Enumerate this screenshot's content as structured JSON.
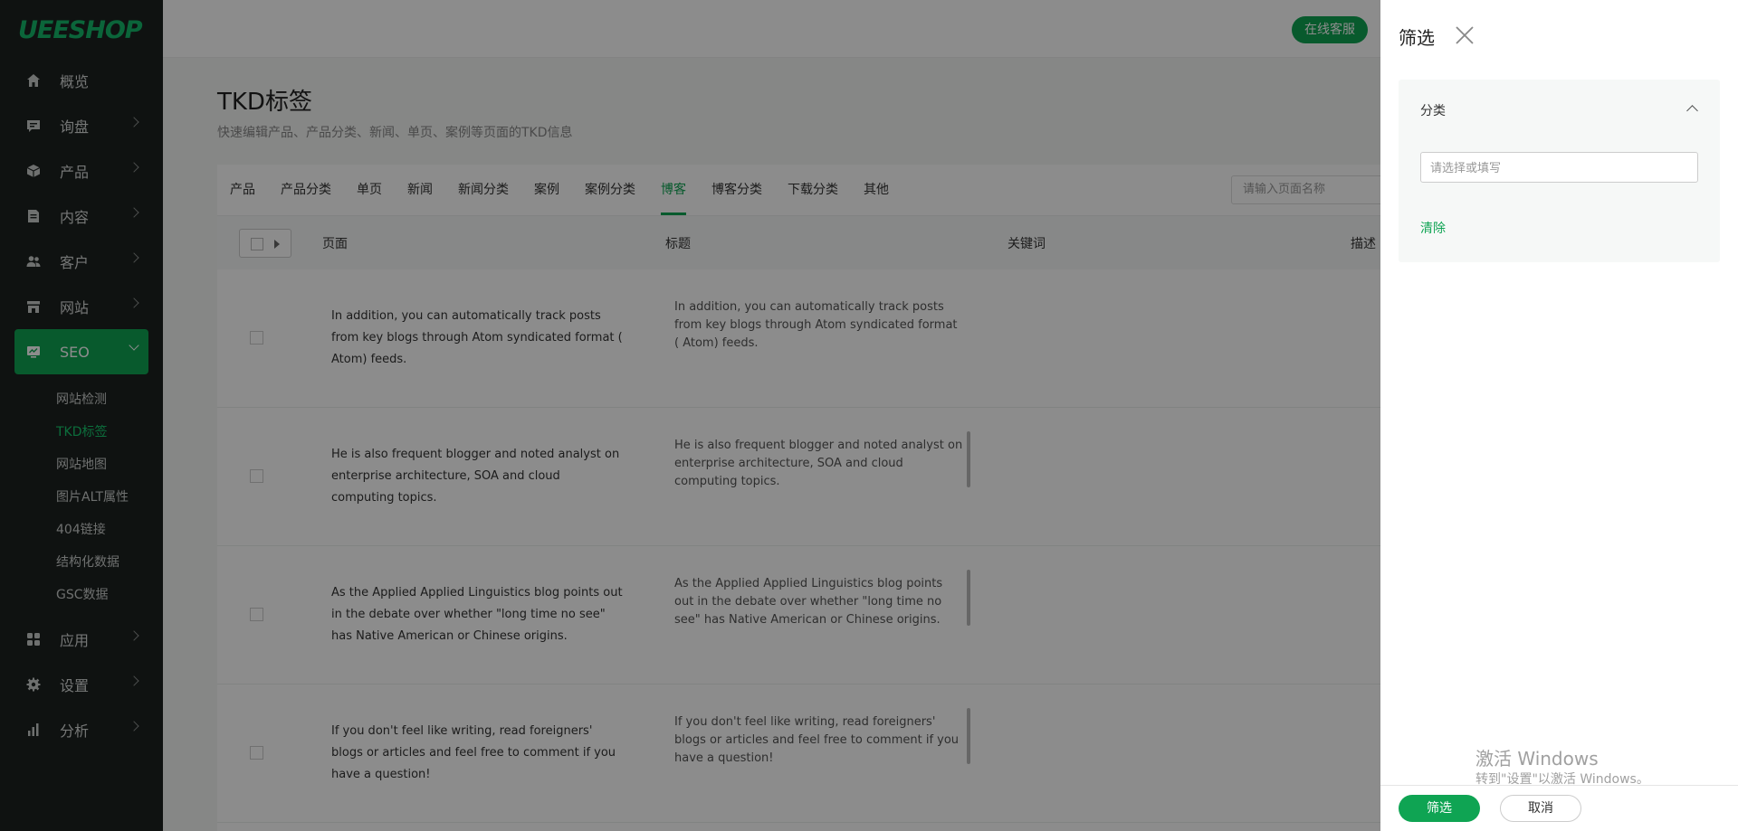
{
  "brand": {
    "logo_text": "UEESHOP"
  },
  "sidebar": {
    "items": [
      {
        "label": "概览",
        "icon": "home-icon"
      },
      {
        "label": "询盘",
        "icon": "chat-icon"
      },
      {
        "label": "产品",
        "icon": "box-icon"
      },
      {
        "label": "内容",
        "icon": "document-icon"
      },
      {
        "label": "客户",
        "icon": "users-icon"
      },
      {
        "label": "网站",
        "icon": "store-icon"
      },
      {
        "label": "SEO",
        "icon": "monitor-icon"
      },
      {
        "label": "应用",
        "icon": "apps-icon"
      },
      {
        "label": "设置",
        "icon": "gear-icon"
      },
      {
        "label": "分析",
        "icon": "bar-chart-icon"
      }
    ],
    "seo_sub": [
      "网站检测",
      "TKD标签",
      "网站地图",
      "图片ALT属性",
      "404链接",
      "结构化数据",
      "GSC数据"
    ]
  },
  "topbar": {
    "online_service": "在线客服"
  },
  "page": {
    "title": "TKD标签",
    "subtitle": "快速编辑产品、产品分类、新闻、单页、案例等页面的TKD信息"
  },
  "tabs": [
    "产品",
    "产品分类",
    "单页",
    "新闻",
    "新闻分类",
    "案例",
    "案例分类",
    "博客",
    "博客分类",
    "下载分类",
    "其他"
  ],
  "search": {
    "placeholder": "请输入页面名称"
  },
  "table": {
    "headers": {
      "page": "页面",
      "title": "标题",
      "keywords": "关键词",
      "description": "描述"
    },
    "rows": [
      {
        "page": "In addition, you can automatically track posts from key blogs through Atom syndicated format ( Atom) feeds.",
        "title": "In addition, you can automatically track posts from key blogs through Atom syndicated format ( Atom) feeds."
      },
      {
        "page": "He is also frequent blogger and noted analyst on enterprise architecture, SOA and cloud computing topics.",
        "title": "He is also frequent blogger and noted analyst on enterprise architecture, SOA and cloud computing topics."
      },
      {
        "page": "As the Applied Applied Linguistics blog points out in the debate over whether \"long time no see\" has Native American or Chinese origins.",
        "title": "As the Applied Applied Linguistics blog points out in the debate over whether \"long time no see\" has Native American or Chinese origins."
      },
      {
        "page": "If you don't feel like writing, read foreigners' blogs or articles and feel free to comment if you have a question!",
        "title": "If you don't feel like writing, read foreigners' blogs or articles and feel free to comment if you have a question!"
      }
    ]
  },
  "drawer": {
    "title": "筛选",
    "section_label": "分类",
    "input_placeholder": "请选择或填写",
    "clear": "清除",
    "submit": "筛选",
    "cancel": "取消"
  },
  "watermark": {
    "line1": "激活 Windows",
    "line2": "转到\"设置\"以激活 Windows。"
  },
  "colors": {
    "accent": "#0fa453",
    "sidebar_bg": "#1d2120"
  }
}
